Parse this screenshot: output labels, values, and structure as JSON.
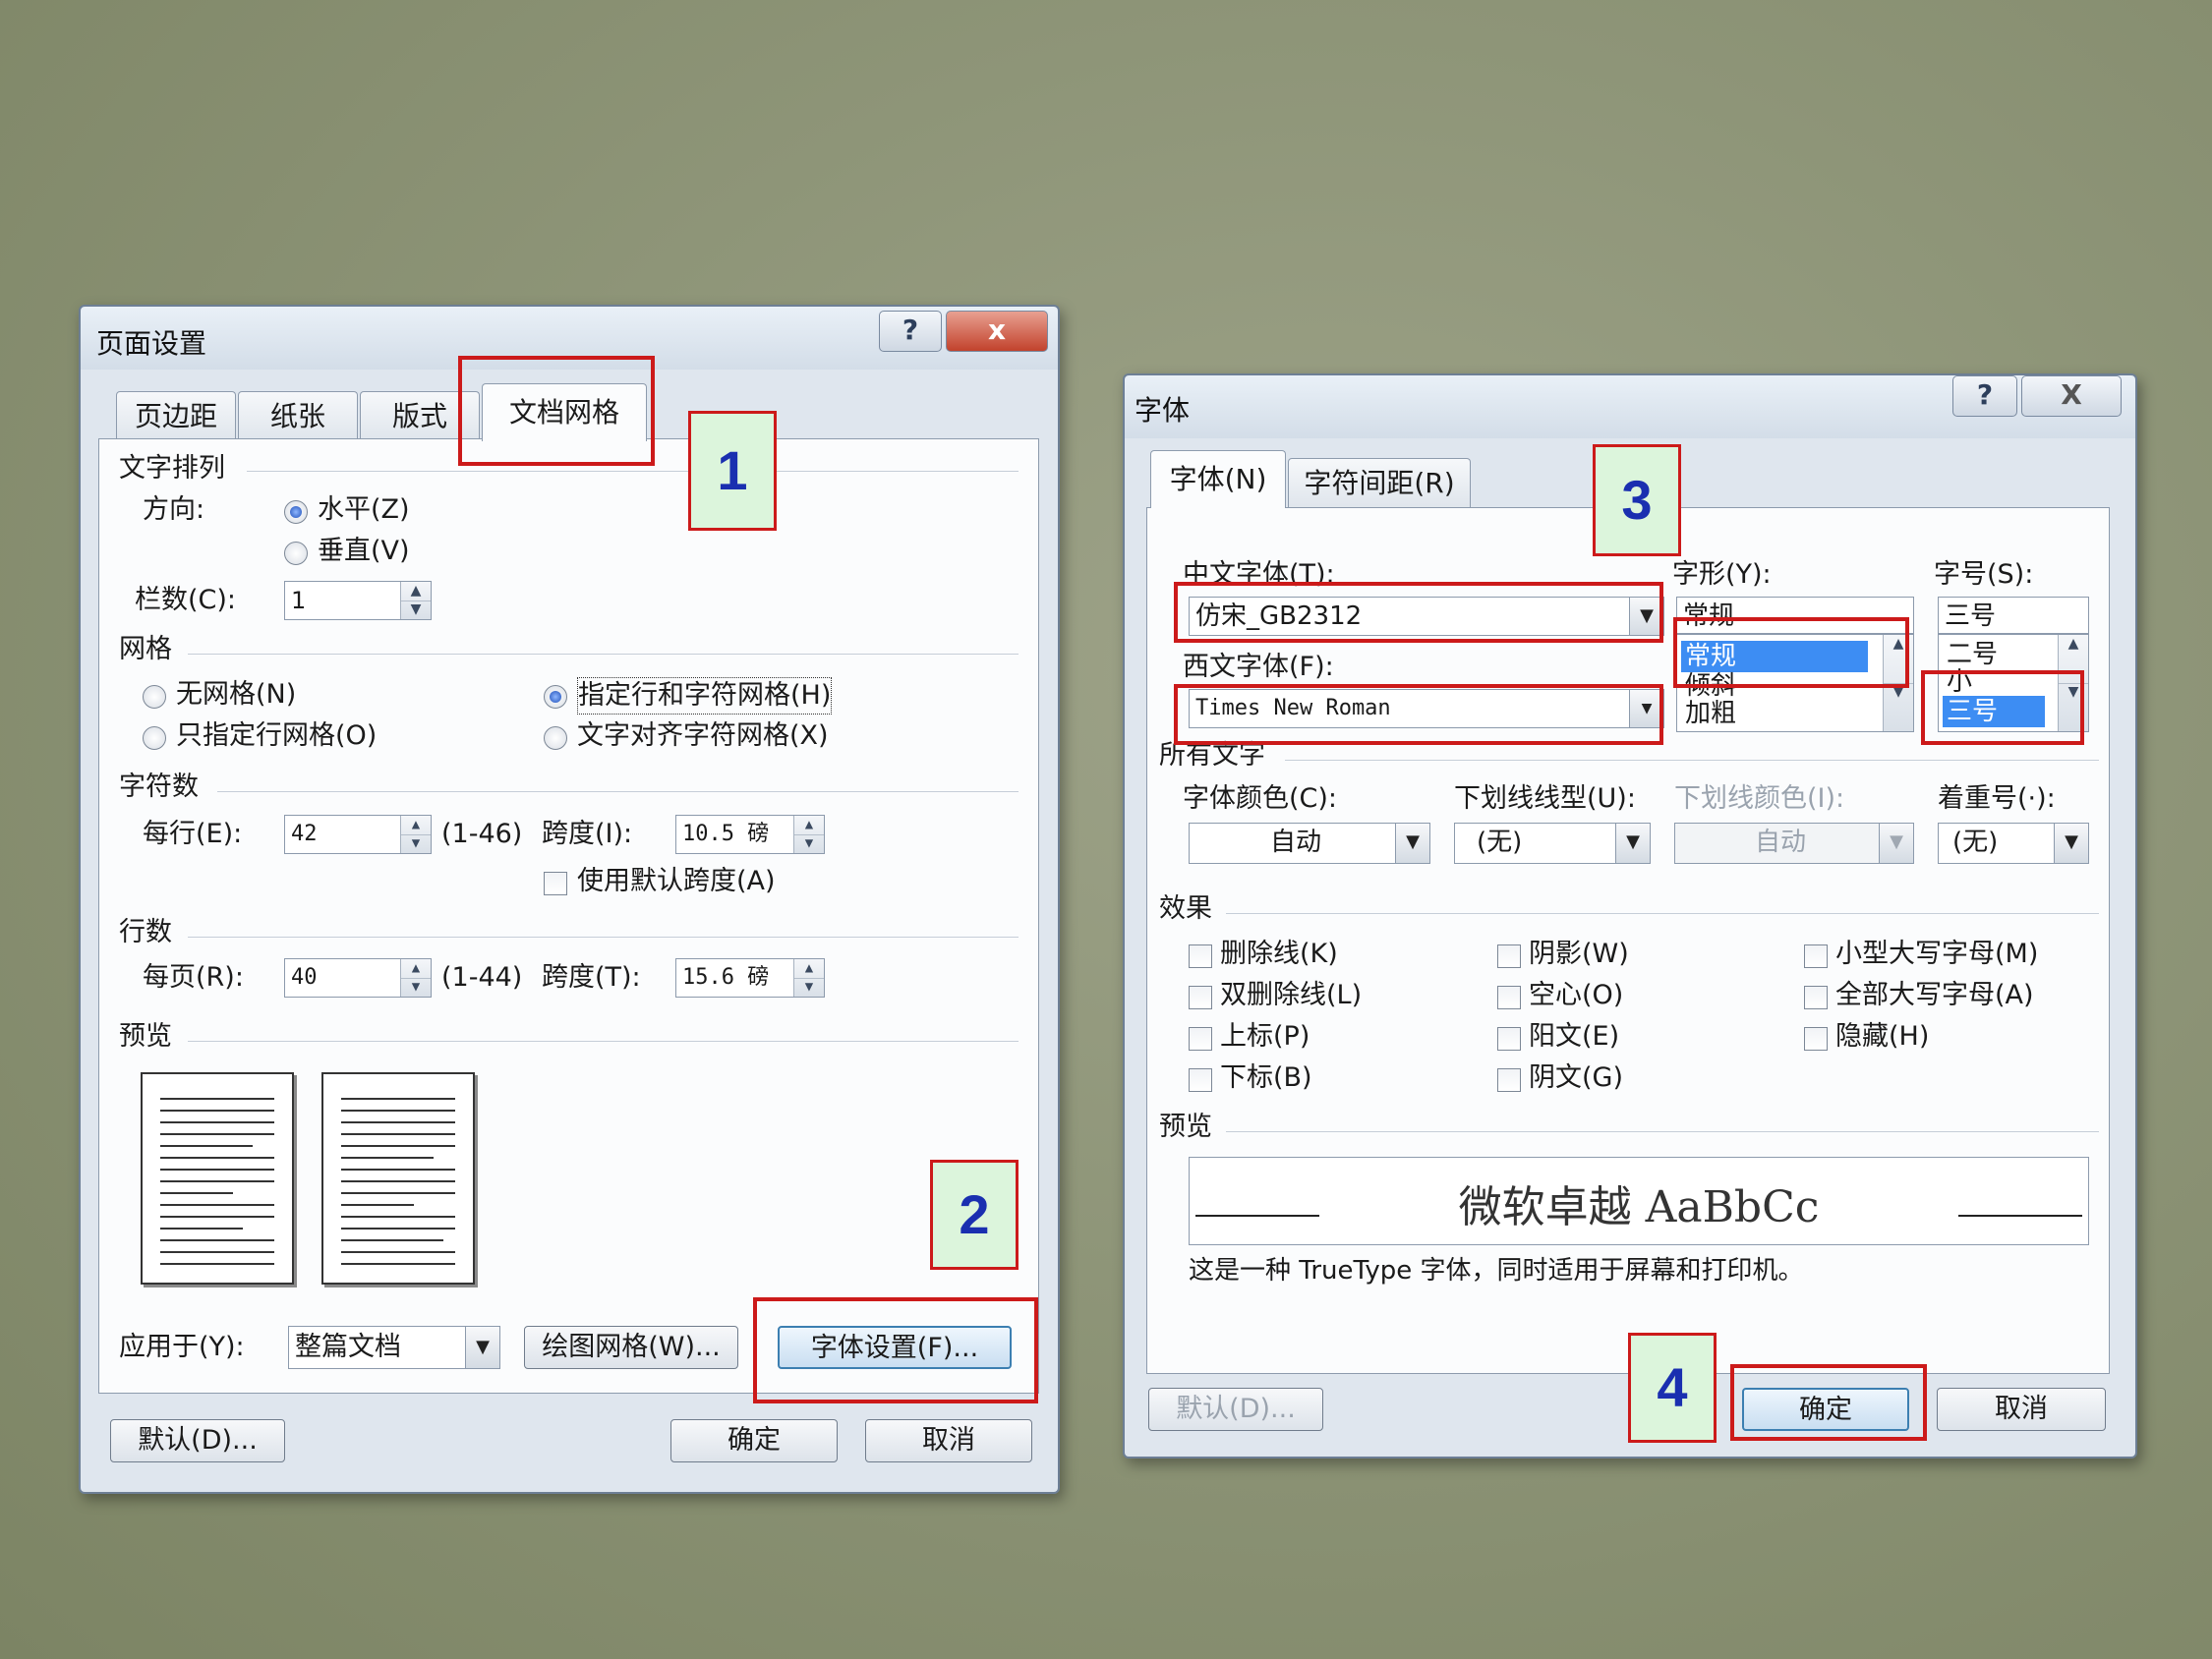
{
  "page_setup": {
    "title": "页面设置",
    "help": "?",
    "close": "x",
    "tabs": [
      "页边距",
      "纸张",
      "版式",
      "文档网格"
    ],
    "text_direction": {
      "section": "文字排列",
      "direction_label": "方向:",
      "horizontal": "水平(Z)",
      "vertical": "垂直(V)",
      "columns_label": "栏数(C):",
      "columns_value": "1"
    },
    "grid": {
      "section": "网格",
      "no_grid": "无网格(N)",
      "line_grid": "只指定行网格(O)",
      "line_char_grid": "指定行和字符网格(H)",
      "char_align_grid": "文字对齐字符网格(X)"
    },
    "chars": {
      "section": "字符数",
      "per_line_label": "每行(E):",
      "per_line_value": "42",
      "per_line_range": "(1-46)",
      "pitch_label": "跨度(I):",
      "pitch_value": "10.5 磅",
      "default_pitch": "使用默认跨度(A)"
    },
    "lines": {
      "section": "行数",
      "per_page_label": "每页(R):",
      "per_page_value": "40",
      "per_page_range": "(1-44)",
      "pitch_label": "跨度(T):",
      "pitch_value": "15.6 磅"
    },
    "preview": {
      "section": "预览"
    },
    "apply_label": "应用于(Y):",
    "apply_value": "整篇文档",
    "drawing_grid_button": "绘图网格(W)...",
    "font_settings_button": "字体设置(F)...",
    "default_button": "默认(D)...",
    "ok_button": "确定",
    "cancel_button": "取消"
  },
  "font_dialog": {
    "title": "字体",
    "help": "?",
    "close": "X",
    "tabs": [
      "字体(N)",
      "字符间距(R)"
    ],
    "chinese_font_label": "中文字体(T):",
    "chinese_font_value": "仿宋_GB2312",
    "western_font_label": "西文字体(F):",
    "western_font_value": "Times New Roman",
    "style_label": "字形(Y):",
    "style_value": "常规",
    "style_list": [
      "常规",
      "倾斜",
      "加粗"
    ],
    "size_label": "字号(S):",
    "size_value": "三号",
    "size_list": [
      "二号",
      "小",
      "三号"
    ],
    "all_text": {
      "section": "所有文字",
      "font_color_label": "字体颜色(C):",
      "font_color_value": "自动",
      "underline_label": "下划线线型(U):",
      "underline_value": "(无)",
      "underline_color_label": "下划线颜色(I):",
      "underline_color_value": "自动",
      "emphasis_label": "着重号(·):",
      "emphasis_value": "(无)"
    },
    "effects": {
      "section": "效果",
      "items": [
        "删除线(K)",
        "双删除线(L)",
        "上标(P)",
        "下标(B)",
        "阴影(W)",
        "空心(O)",
        "阳文(E)",
        "阴文(G)",
        "小型大写字母(M)",
        "全部大写字母(A)",
        "隐藏(H)"
      ]
    },
    "preview": {
      "section": "预览",
      "sample": "微软卓越 AaBbCc",
      "note": "这是一种 TrueType 字体，同时适用于屏幕和打印机。"
    },
    "default_button": "默认(D)...",
    "ok_button": "确定",
    "cancel_button": "取消"
  },
  "callouts": [
    "1",
    "2",
    "3",
    "4"
  ]
}
